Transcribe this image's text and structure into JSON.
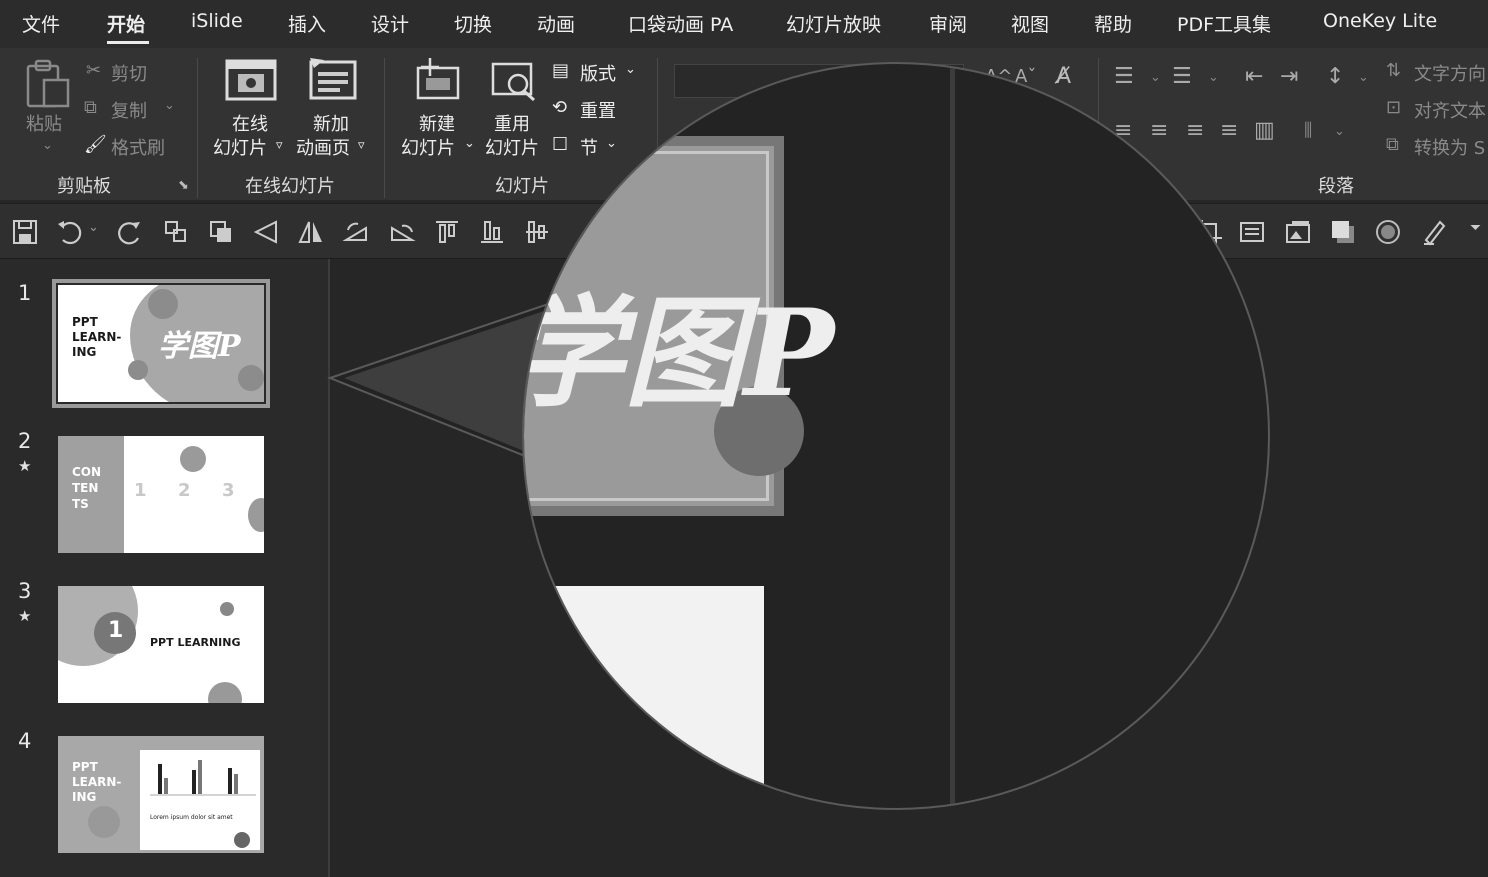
{
  "tabs": [
    "文件",
    "开始",
    "iSlide",
    "插入",
    "设计",
    "切换",
    "动画",
    "口袋动画 PA",
    "幻灯片放映",
    "审阅",
    "视图",
    "帮助",
    "PDF工具集",
    "OneKey Lite"
  ],
  "ribbon": {
    "clipboard": {
      "paste": "粘贴",
      "cut": "剪切",
      "copy": "复制",
      "format_painter": "格式刷",
      "group": "剪贴板"
    },
    "online": {
      "online_slide_1": "在线",
      "online_slide_2": "幻灯片",
      "new_anim_1": "新加",
      "new_anim_2": "动画页",
      "group": "在线幻灯片"
    },
    "slides": {
      "new_1": "新建",
      "new_2": "幻灯片",
      "reuse_1": "重用",
      "reuse_2": "幻灯片",
      "layout": "版式",
      "reset": "重置",
      "section": "节",
      "group": "幻灯片"
    },
    "paragraph": {
      "text_direction": "文字方向",
      "align_text": "对齐文本",
      "convert": "转换为 S",
      "group": "段落"
    }
  },
  "slides": [
    {
      "num": "1",
      "star": "",
      "title": "PPT\nLEARN-\nING",
      "logo": "学图P"
    },
    {
      "num": "2",
      "star": "★",
      "title": "CON\nTEN\nTS"
    },
    {
      "num": "3",
      "star": "★",
      "title": "PPT LEARNING",
      "badge": "1"
    },
    {
      "num": "4",
      "star": "",
      "title": "PPT\nLEARN-\nING",
      "caption": "Lorem ipsum dolor sit amet"
    }
  ],
  "colors": {
    "bg": "#262626",
    "ribbon": "#333333",
    "thumb_gray": "#a8a8a8"
  }
}
